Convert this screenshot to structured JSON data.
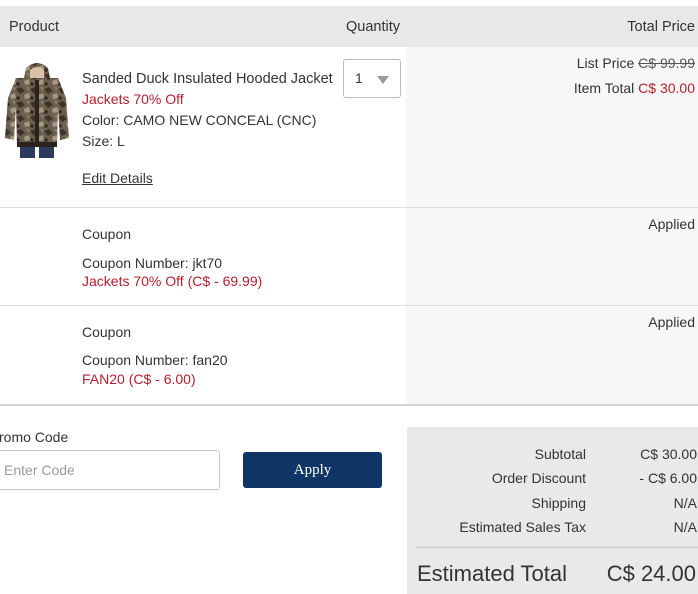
{
  "header": {
    "product": "Product",
    "quantity": "Quantity",
    "total_price": "Total Price"
  },
  "item": {
    "name": "Sanded Duck Insulated Hooded Jacket",
    "promo": "Jackets 70% Off",
    "color": "Color: CAMO NEW CONCEAL (CNC)",
    "size": "Size: L",
    "edit": "Edit Details",
    "quantity": "1",
    "list_price_label": "List Price",
    "list_price": "C$ 99.99",
    "item_total_label": "Item Total",
    "item_total": "C$ 30.00",
    "image_icon": "camo-jacket-photo"
  },
  "coupons": [
    {
      "title": "Coupon",
      "number": "Coupon Number: jkt70",
      "discount": "Jackets 70% Off (C$ - 69.99)",
      "status": "Applied"
    },
    {
      "title": "Coupon",
      "number": "Coupon Number: fan20",
      "discount": "FAN20 (C$ - 6.00)",
      "status": "Applied"
    }
  ],
  "promo": {
    "label": "romo Code",
    "placeholder": "Enter Code",
    "apply": "Apply"
  },
  "summary": {
    "subtotal_label": "Subtotal",
    "subtotal": "C$ 30.00",
    "discount_label": "Order Discount",
    "discount": "- C$ 6.00",
    "shipping_label": "Shipping",
    "shipping": "N/A",
    "tax_label": "Estimated Sales Tax",
    "tax": "N/A",
    "est_total_label": "Estimated Total",
    "est_total": "C$ 24.00"
  },
  "colors": {
    "accent_red": "#b5202e",
    "button_navy": "#0f3566"
  }
}
